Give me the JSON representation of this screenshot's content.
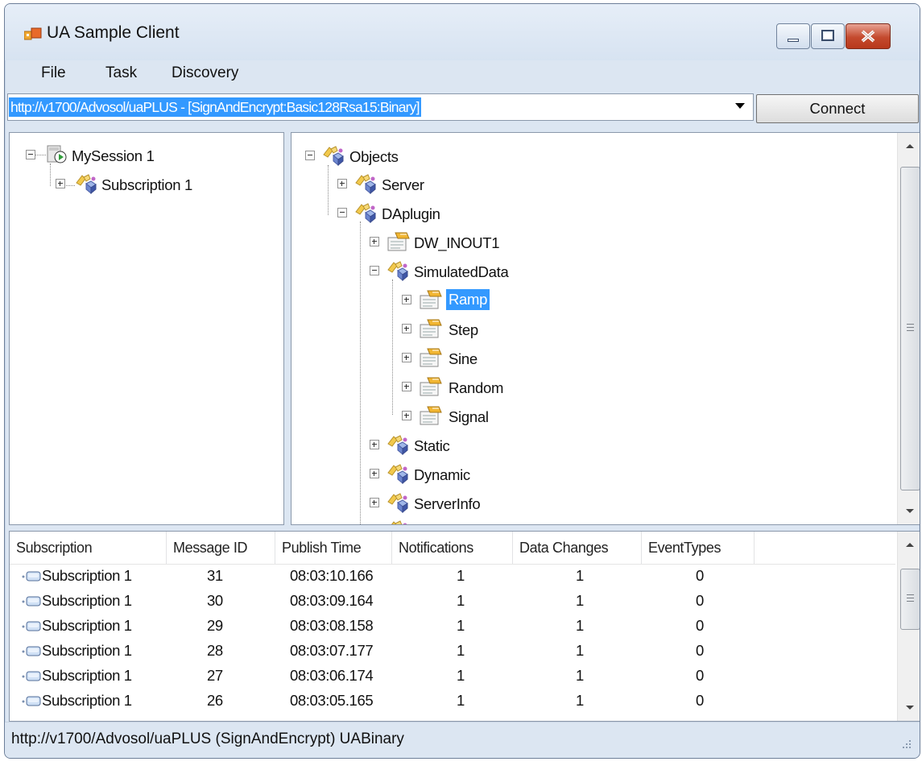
{
  "window": {
    "title": "UA Sample Client"
  },
  "menu": [
    "File",
    "Task",
    "Discovery"
  ],
  "endpoint": {
    "url": "http://v1700/Advosol/uaPLUS - [SignAndEncrypt:Basic128Rsa15:Binary]",
    "connect_label": "Connect"
  },
  "sessions": {
    "session": "MySession 1",
    "subscription": "Subscription 1"
  },
  "address_tree": {
    "root": "Objects",
    "server": "Server",
    "daplugin": "DAplugin",
    "dw_inout1": "DW_INOUT1",
    "simulated": "SimulatedData",
    "items": [
      "Ramp",
      "Step",
      "Sine",
      "Random",
      "Signal"
    ],
    "selected": "Ramp",
    "static": "Static",
    "dynamic": "Dynamic",
    "serverinfo": "ServerInfo"
  },
  "notifications": {
    "columns": [
      "Subscription",
      "Message ID",
      "Publish Time",
      "Notifications",
      "Data Changes",
      "EventTypes"
    ],
    "rows": [
      {
        "subscription": "Subscription 1",
        "message_id": "31",
        "publish_time": "08:03:10.166",
        "notifications": "1",
        "data_changes": "1",
        "event_types": "0"
      },
      {
        "subscription": "Subscription 1",
        "message_id": "30",
        "publish_time": "08:03:09.164",
        "notifications": "1",
        "data_changes": "1",
        "event_types": "0"
      },
      {
        "subscription": "Subscription 1",
        "message_id": "29",
        "publish_time": "08:03:08.158",
        "notifications": "1",
        "data_changes": "1",
        "event_types": "0"
      },
      {
        "subscription": "Subscription 1",
        "message_id": "28",
        "publish_time": "08:03:07.177",
        "notifications": "1",
        "data_changes": "1",
        "event_types": "0"
      },
      {
        "subscription": "Subscription 1",
        "message_id": "27",
        "publish_time": "08:03:06.174",
        "notifications": "1",
        "data_changes": "1",
        "event_types": "0"
      },
      {
        "subscription": "Subscription 1",
        "message_id": "26",
        "publish_time": "08:03:05.165",
        "notifications": "1",
        "data_changes": "1",
        "event_types": "0"
      }
    ]
  },
  "status": {
    "text": "http://v1700/Advosol/uaPLUS (SignAndEncrypt) UABinary"
  },
  "colors": {
    "selection": "#3399ff",
    "window_frame": "#dce6f2",
    "close_button": "#c44a2e"
  },
  "icons": {
    "app": "app-icon",
    "session": "session-icon",
    "folder_object": "object-folder-icon",
    "variable": "variable-icon",
    "subscription_row": "subscription-icon"
  }
}
